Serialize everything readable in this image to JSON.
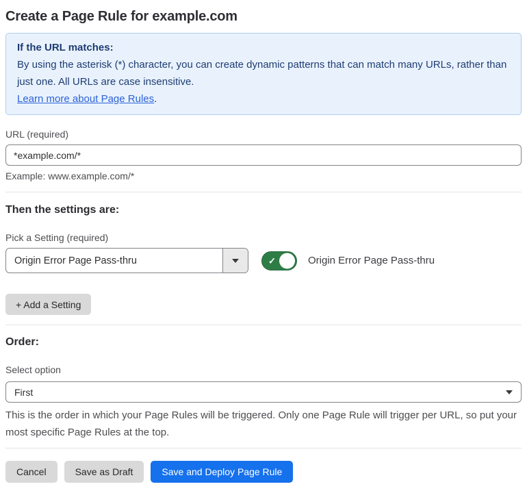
{
  "page": {
    "title": "Create a Page Rule for example.com"
  },
  "info_box": {
    "heading": "If the URL matches:",
    "body": "By using the asterisk (*) character, you can create dynamic patterns that can match many URLs, rather than just one. All URLs are case insensitive.",
    "link_label": "Learn more about Page Rules",
    "link_suffix": "."
  },
  "url_section": {
    "label": "URL (required)",
    "input_value": "*example.com/*",
    "helper": "Example: www.example.com/*"
  },
  "settings_section": {
    "heading": "Then the settings are:",
    "picker_label": "Pick a Setting (required)",
    "selected_setting": "Origin Error Page Pass-thru",
    "toggle_state": "on",
    "toggle_label": "Origin Error Page Pass-thru",
    "add_setting_label": "+ Add a Setting"
  },
  "order_section": {
    "heading": "Order:",
    "select_label": "Select option",
    "selected_option": "First",
    "helper": "This is the order in which your Page Rules will be triggered. Only one Page Rule will trigger per URL, so put your most specific Page Rules at the top."
  },
  "footer": {
    "cancel_label": "Cancel",
    "save_draft_label": "Save as Draft",
    "save_deploy_label": "Save and Deploy Page Rule"
  },
  "icons": {
    "check": "✓"
  },
  "colors": {
    "info_bg": "#e9f2fc",
    "info_border": "#aecdf0",
    "info_text": "#1e3c73",
    "link": "#2b62d9",
    "toggle_on": "#2e7d46",
    "primary_button": "#1671ec",
    "secondary_button": "#d9d9d9"
  }
}
